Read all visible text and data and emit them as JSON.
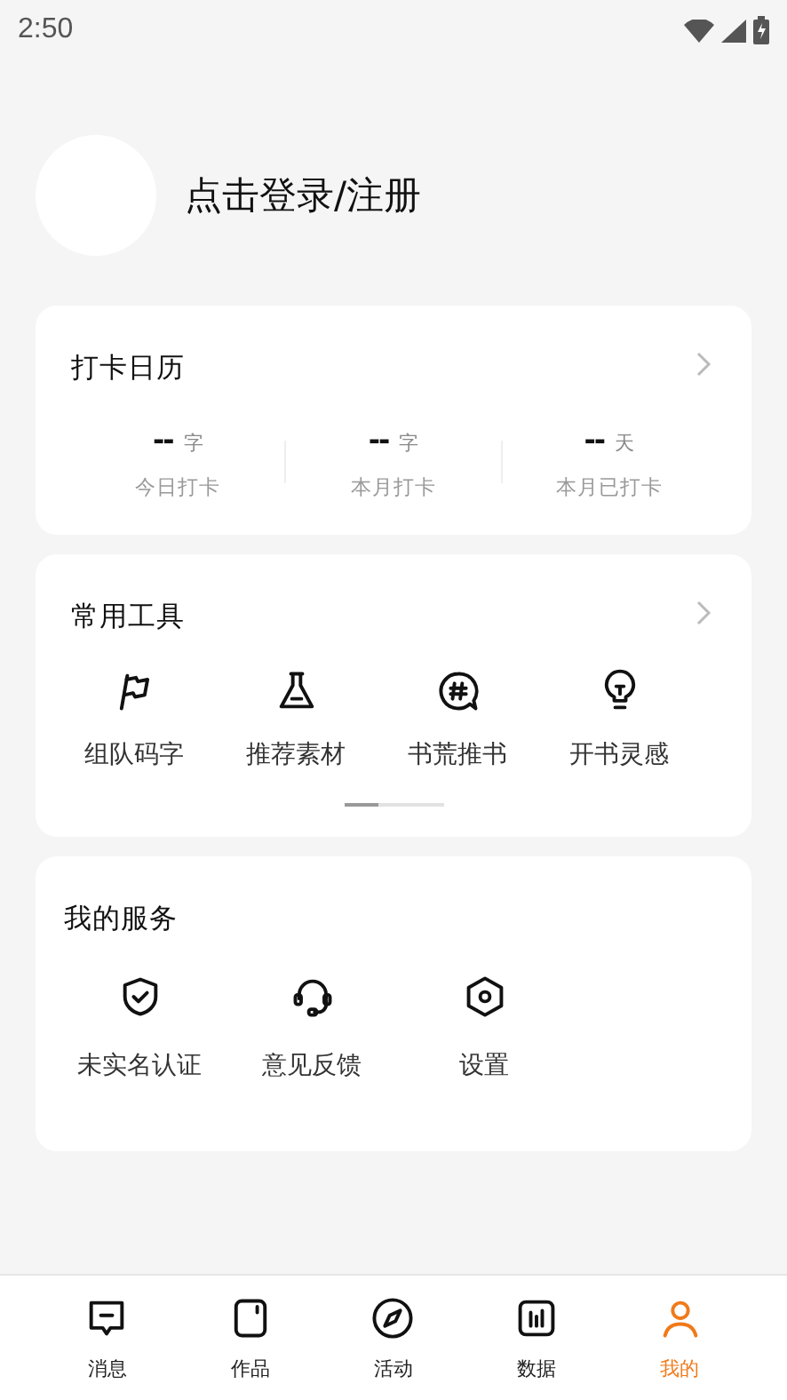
{
  "status_bar": {
    "time": "2:50"
  },
  "profile": {
    "login_text": "点击登录/注册"
  },
  "checkin_card": {
    "title": "打卡日历",
    "stats": [
      {
        "value": "--",
        "unit": "字",
        "label": "今日打卡"
      },
      {
        "value": "--",
        "unit": "字",
        "label": "本月打卡"
      },
      {
        "value": "--",
        "unit": "天",
        "label": "本月已打卡"
      }
    ]
  },
  "tools_card": {
    "title": "常用工具",
    "items": [
      {
        "kind": "flag",
        "label": "组队码字"
      },
      {
        "kind": "flask",
        "label": "推荐素材"
      },
      {
        "kind": "hashtag",
        "label": "书荒推书"
      },
      {
        "kind": "bulb",
        "label": "开书灵感"
      }
    ]
  },
  "services_card": {
    "title": "我的服务",
    "items": [
      {
        "kind": "shield",
        "label": "未实名认证"
      },
      {
        "kind": "headset",
        "label": "意见反馈"
      },
      {
        "kind": "hexagon",
        "label": "设置"
      }
    ]
  },
  "bottom_nav": [
    {
      "kind": "message",
      "label": "消息",
      "selected": false
    },
    {
      "kind": "works",
      "label": "作品",
      "selected": false
    },
    {
      "kind": "compass",
      "label": "活动",
      "selected": false
    },
    {
      "kind": "data",
      "label": "数据",
      "selected": false
    },
    {
      "kind": "person",
      "label": "我的",
      "selected": true
    }
  ]
}
